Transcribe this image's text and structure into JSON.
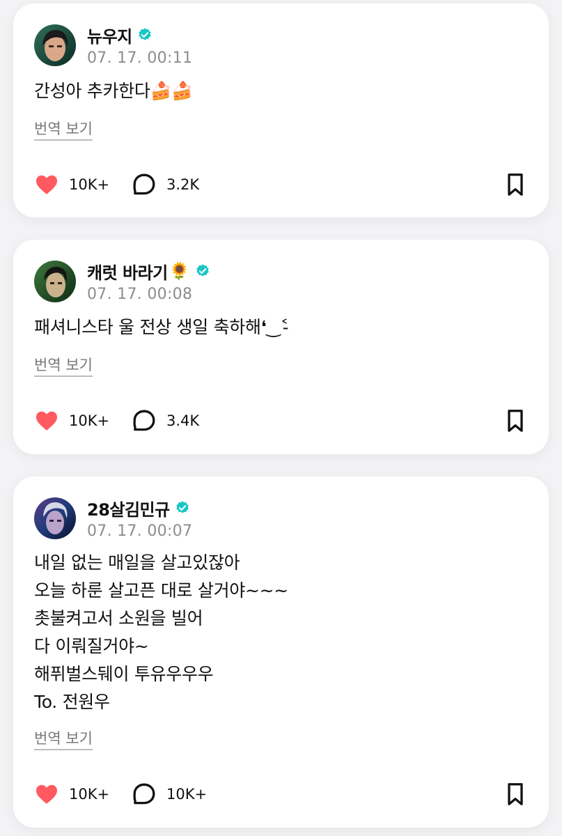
{
  "posts": [
    {
      "author": "뉴우지",
      "name_emoji": "",
      "verified": true,
      "timestamp": "07. 17. 00:11",
      "lines": [
        "간성아 추카한다🍰🍰"
      ],
      "translate_label": "번역 보기",
      "likes": "10K+",
      "comments": "3.2K"
    },
    {
      "author": "캐럿 바라기",
      "name_emoji": "🌻",
      "verified": true,
      "timestamp": "07. 17. 00:08",
      "lines": [
        "패셔니스타 울 전상 생일 축하해❛‿˂̵"
      ],
      "translate_label": "번역 보기",
      "likes": "10K+",
      "comments": "3.4K"
    },
    {
      "author": "28살김민규",
      "name_emoji": "",
      "verified": true,
      "timestamp": "07. 17. 00:07",
      "lines": [
        "내일 없는 매일을 살고있잖아",
        "오늘 하룬 살고픈 대로 살거야~~~",
        "촛불켜고서 소원을 빌어",
        "다 이뤄질거야~",
        "해퓌벌스뒈이 투유우우우",
        "To. 전원우"
      ],
      "translate_label": "번역 보기",
      "likes": "10K+",
      "comments": "10K+"
    }
  ],
  "colors": {
    "like": "#ff5a5f",
    "verified": "#19c6c6",
    "muted": "#8c8c8c"
  },
  "icons": {
    "like": "heart-icon",
    "comment": "speech-bubble-icon",
    "bookmark": "bookmark-icon",
    "verified": "verified-badge-icon"
  }
}
